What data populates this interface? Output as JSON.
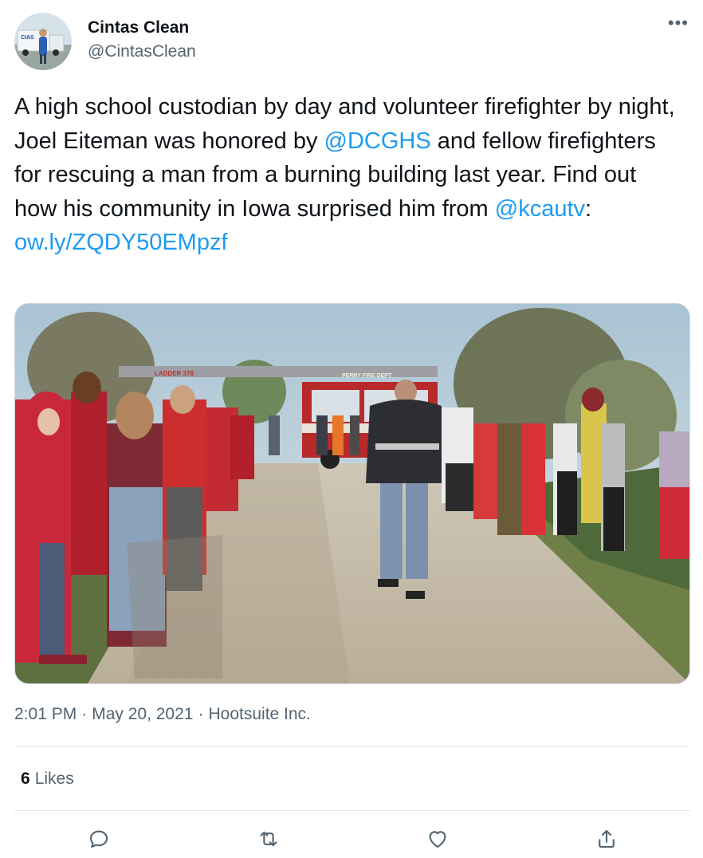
{
  "author": {
    "name": "Cintas Clean",
    "handle": "@CintasClean",
    "avatar_icon": "avatar-person-truck"
  },
  "menu_icon": "more-options-icon",
  "tweet": {
    "segments": [
      {
        "text": "A high school custodian by day and volunteer firefighter by night, Joel Eiteman was honored by ",
        "link": false
      },
      {
        "text": "@DCGHS",
        "link": true
      },
      {
        "text": " and fellow firefighters for rescuing a man from a burning building last year. Find out how his community in Iowa surprised him from ",
        "link": true,
        "plain": true
      },
      {
        "text": "@kcautv",
        "link": true
      },
      {
        "text": ":",
        "link": false
      },
      {
        "text": "ow.ly/ZQDY50EMpzf",
        "link": true
      }
    ],
    "text_before_dcghs": "A high school custodian by day and volunteer firefighter by night, Joel Eiteman was honored by ",
    "mention_1": "@DCGHS",
    "text_before_kcautv": " and fellow firefighters for rescuing a man from a burning building last year. Find out how his community in Iowa surprised him from ",
    "mention_2": "@kcautv",
    "colon": ":",
    "url": "ow.ly/ZQDY50EMpzf"
  },
  "media": {
    "truck_sign": "PERRY FIRE DEPT",
    "ladder_text": "LADDER 378"
  },
  "meta": {
    "time": "2:01 PM",
    "separator": "·",
    "date": "May 20, 2021",
    "source": "Hootsuite Inc."
  },
  "stats": {
    "likes_count": "6",
    "likes_label": "Likes"
  },
  "actions": {
    "reply": "reply-icon",
    "retweet": "retweet-icon",
    "like": "heart-icon",
    "share": "share-icon"
  },
  "colors": {
    "link": "#1d9bf0",
    "text": "#0f1419",
    "secondary": "#536471",
    "divider": "#e1e8ed"
  }
}
